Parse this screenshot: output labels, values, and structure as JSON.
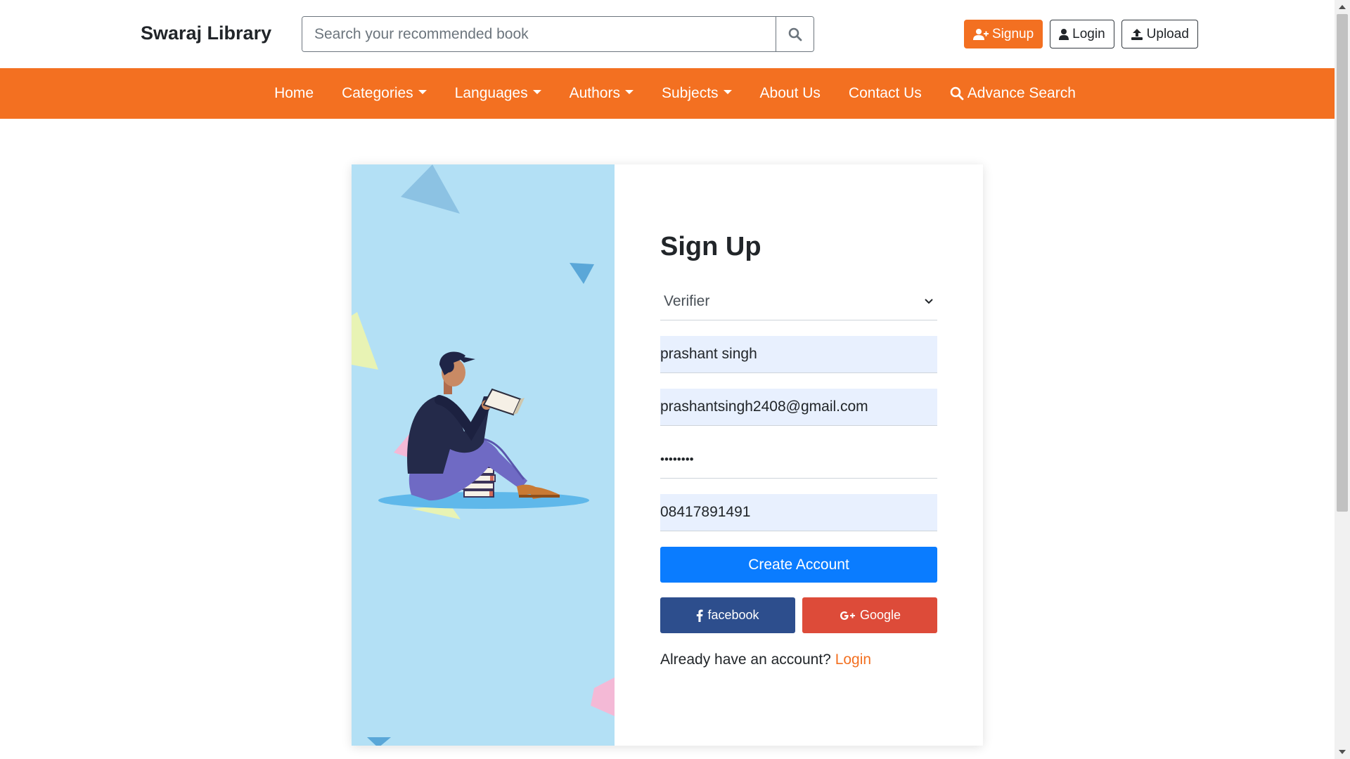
{
  "brand": "Swaraj Library",
  "search": {
    "placeholder": "Search your recommended book"
  },
  "top_actions": {
    "signup": "Signup",
    "login": "Login",
    "upload": "Upload"
  },
  "nav": {
    "home": "Home",
    "categories": "Categories",
    "languages": "Languages",
    "authors": "Authors",
    "subjects": "Subjects",
    "about": "About Us",
    "contact": "Contact Us",
    "advance_search": "Advance Search"
  },
  "form": {
    "title": "Sign Up",
    "role": "Verifier",
    "name": "prashant singh",
    "email": "prashantsingh2408@gmail.com",
    "password_mask": "••••••••",
    "phone": "08417891491",
    "create_button": "Create Account",
    "facebook_button": "facebook",
    "google_button": "Google",
    "already_text": "Already have an account?",
    "login_link": "Login"
  },
  "colors": {
    "brand_orange": "#f37021",
    "primary_blue": "#0a7cff",
    "facebook_blue": "#2d4e8d",
    "google_red": "#dd4b39",
    "panel_blue": "#b3e0f5"
  }
}
